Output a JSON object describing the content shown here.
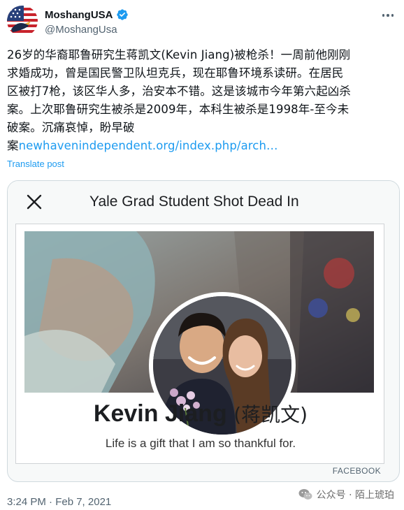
{
  "author": {
    "display_name": "MoshangUSA",
    "handle": "@MoshangUsa",
    "verified": true,
    "verified_color": "#1d9bf0"
  },
  "tweet": {
    "text_lines": [
      "26岁的华裔耶鲁研究生蒋凯文(Kevin Jiang)被枪杀！一周前他刚刚",
      "求婚成功，曾是国民警卫队坦克兵，现在耶鲁环境系读研。在居民",
      "区被打7枪，该区华人多，治安本不错。这是该城市今年第六起凶杀",
      "案。上次耶鲁研究生被杀是2009年，本科生被杀是1998年-至今未",
      "破案。沉痛哀悼，盼早破"
    ],
    "last_line_prefix": "案",
    "link_text": "newhavenindependent.org/index.php/arch…",
    "translate_label": "Translate post",
    "timestamp": "3:24 PM · Feb 7, 2021"
  },
  "card": {
    "title": "Yale Grad Student Shot Dead In",
    "person_name": "Kevin Jiang",
    "person_name_cn": "(蒋凯文)",
    "motto": "Life is a gift that I am so thankful for.",
    "source": "FACEBOOK"
  },
  "watermark": {
    "text": "公众号 · 陌上琥珀",
    "icon": "wechat-icon"
  },
  "colors": {
    "link": "#1d9bf0",
    "text": "#0f1419",
    "muted": "#536471"
  }
}
